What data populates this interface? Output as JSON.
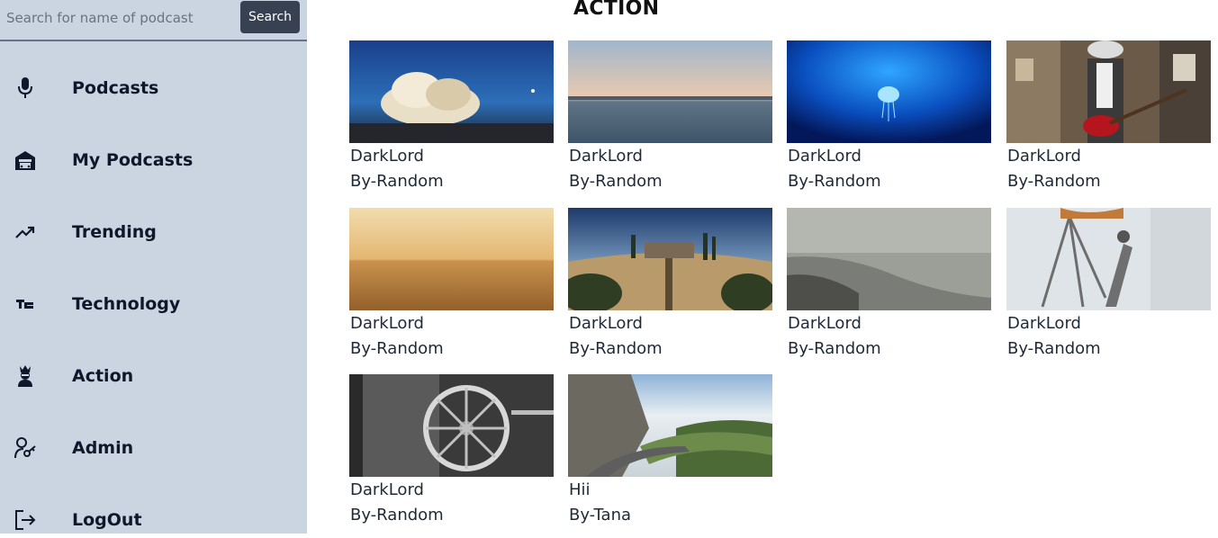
{
  "search": {
    "placeholder": "Search for name of podcast",
    "value": "",
    "button_label": "Search"
  },
  "sidebar": {
    "items": [
      {
        "label": "Podcasts",
        "icon": "microphone-icon"
      },
      {
        "label": "My Podcasts",
        "icon": "garage-icon"
      },
      {
        "label": "Trending",
        "icon": "trending-up-icon"
      },
      {
        "label": "Technology",
        "icon": "techcrunch-icon"
      },
      {
        "label": "Action",
        "icon": "ninja-icon"
      },
      {
        "label": "Admin",
        "icon": "user-key-icon"
      },
      {
        "label": "LogOut",
        "icon": "logout-icon"
      }
    ]
  },
  "main": {
    "title": "ACTION",
    "cards": [
      {
        "title": "DarkLord",
        "author": "By-Random",
        "thumb": "cloud-sky"
      },
      {
        "title": "DarkLord",
        "author": "By-Random",
        "thumb": "calm-sea"
      },
      {
        "title": "DarkLord",
        "author": "By-Random",
        "thumb": "jellyfish"
      },
      {
        "title": "DarkLord",
        "author": "By-Random",
        "thumb": "guitarist"
      },
      {
        "title": "DarkLord",
        "author": "By-Random",
        "thumb": "desert"
      },
      {
        "title": "DarkLord",
        "author": "By-Random",
        "thumb": "tuscany-hill"
      },
      {
        "title": "DarkLord",
        "author": "By-Random",
        "thumb": "foggy-coast"
      },
      {
        "title": "DarkLord",
        "author": "By-Random",
        "thumb": "tripod-stand"
      },
      {
        "title": "DarkLord",
        "author": "By-Random",
        "thumb": "wagon-wheel"
      },
      {
        "title": "Hii",
        "author": "By-Tana",
        "thumb": "mountain-road"
      }
    ]
  },
  "colors": {
    "sidebar_bg": "#cbd5e1",
    "search_button_bg": "#374151",
    "text_dark": "#0f172a"
  }
}
